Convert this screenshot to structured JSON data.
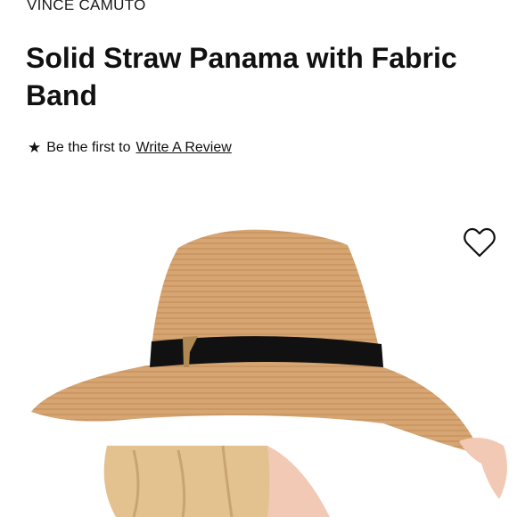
{
  "product": {
    "brand": "VINCE CAMUTO",
    "title": "Solid Straw Panama with Fabric Band"
  },
  "reviews": {
    "prefix": "Be the first to",
    "link_label": "Write A Review",
    "star_icon": "star-icon"
  },
  "image": {
    "wishlist_icon": "heart-outline-icon",
    "colors": {
      "straw": "#d6a572",
      "band": "#111111",
      "hair": "#e3c28f",
      "skin": "#f2c9b4"
    }
  }
}
